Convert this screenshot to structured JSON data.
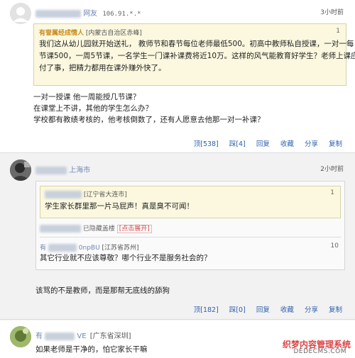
{
  "comments": [
    {
      "user_suffix": "网友",
      "ip": "106.91.*.*",
      "time": "3小时前",
      "quote": {
        "user": "有誉属经成情人",
        "location": "[内蒙古自治区赤峰]",
        "number": "1",
        "lines": [
          "我们这从幼儿园就开始送礼， 教师节和春节每位老师最低500。初高中教师私自授课，一对一每",
          "节课500，一周5节课，一名学生一门课补课费将近10万。这样的风气能教育好学生？老师上课应",
          "付了事，把精力都用在课外赚外快了。"
        ]
      },
      "text_lines": [
        "一对一授课  他一周能授几节课？",
        "在课堂上不讲，其他的学生怎么办？",
        "学校都有教绩考核的，他考核倒数了，还有人愿意去他那一对一补课？"
      ],
      "actions": [
        "顶[538]",
        "踩[4]",
        "回复",
        "收藏",
        "分享",
        "复制"
      ]
    },
    {
      "location": "上海市",
      "time": "2小时前",
      "quote": {
        "location": "[辽宁省大连市]",
        "number": "1",
        "line": "学生家长群里那一片马屁声！真是臭不可闻！"
      },
      "hidden": {
        "text": "已隐藏盖楼",
        "expand": "[点击展开]"
      },
      "reply": {
        "user": "有",
        "user_tail": "0npBU",
        "location": "[江苏省苏州]",
        "number": "10",
        "line": "其它行业就不应该尊敬？哪个行业不是服务社会的？"
      },
      "text": "该骂的不是教师，而是那帮无底线的舔狗",
      "actions": [
        "顶[182]",
        "踩[0]",
        "回复",
        "收藏",
        "分享",
        "复制"
      ]
    },
    {
      "user": "有",
      "user_tail": "VE",
      "location": "[广东省深圳]",
      "text": "如果老师是干净的，怕它家长干嘛"
    }
  ],
  "watermark": {
    "title": "织梦内容管理系统",
    "url": "DEDECMS.COM"
  },
  "colors": {
    "link": "#2f62ad",
    "user": "#6b86b6",
    "quote_bg": "#fbf8df",
    "gold": "#c98b1c"
  }
}
